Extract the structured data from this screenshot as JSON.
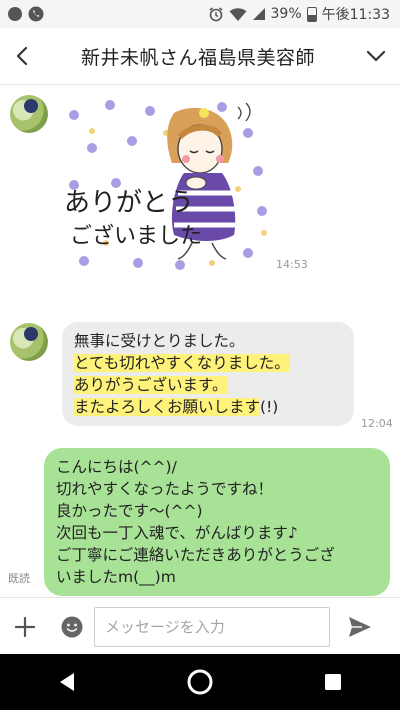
{
  "status_bar": {
    "battery": "39%",
    "time": "午後11:33",
    "icons": [
      "notification-icon",
      "phone-icon",
      "alarm-icon",
      "wifi-icon",
      "signal-icon",
      "battery-icon"
    ]
  },
  "header": {
    "title": "新井未帆さん福島県美容師",
    "back_icon": "chevron-left-icon",
    "menu_icon": "chevron-down-icon"
  },
  "messages": [
    {
      "direction": "incoming",
      "kind": "sticker",
      "sticker_text": [
        "ありがとう",
        "ございました"
      ],
      "time": "14:53"
    },
    {
      "direction": "incoming",
      "kind": "text",
      "lines": [
        {
          "text": "無事に受けとりました。",
          "highlight": false
        },
        {
          "text": "とても切れやすくなりました。",
          "highlight": true
        },
        {
          "text": "ありがうございます。",
          "highlight": true
        },
        {
          "text": "またよろしくお願いします",
          "highlight": true,
          "suffix": "(!)"
        }
      ],
      "time": "12:04"
    },
    {
      "direction": "outgoing",
      "kind": "text",
      "lines": [
        "こんにちは(^^)/",
        "切れやすくなったようですね！",
        "良かったです〜(^^)",
        "次回も一丁入魂で、がんばります♪",
        "ご丁寧にご連絡いただきありがとうござ",
        "いましたm(__)m"
      ],
      "read_label": "既読"
    }
  ],
  "input_bar": {
    "placeholder": "メッセージを入力",
    "plus_icon": "plus-icon",
    "emoji_icon": "emoji-icon",
    "send_icon": "send-icon"
  },
  "nav_bar": {
    "icons": [
      "back-triangle-icon",
      "home-circle-icon",
      "recents-square-icon"
    ]
  },
  "colors": {
    "outgoing_bubble": "#a8e296",
    "incoming_bubble": "#ececec",
    "highlight": "#fff27a",
    "sticker_dress": "#6a4aa8"
  }
}
